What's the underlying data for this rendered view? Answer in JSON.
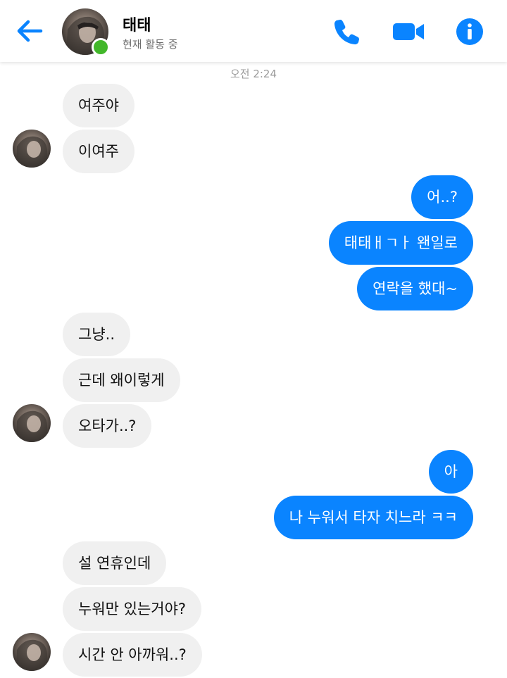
{
  "header": {
    "contact_name": "태태",
    "status": "현재 활동 중",
    "icons": {
      "back": "back-arrow-icon",
      "call": "phone-icon",
      "video": "video-camera-icon",
      "info": "info-icon"
    },
    "accent_color": "#0a84ff"
  },
  "timestamp": "오전 2:24",
  "messages": [
    {
      "from": "them",
      "text": "여주야"
    },
    {
      "from": "them",
      "text": "이여주"
    },
    {
      "from": "me",
      "text": "어..?"
    },
    {
      "from": "me",
      "text": "태태ㅐㄱㅏ 왠일로"
    },
    {
      "from": "me",
      "text": "연락을 했대~"
    },
    {
      "from": "them",
      "text": "그냥.."
    },
    {
      "from": "them",
      "text": "근데 왜이렇게"
    },
    {
      "from": "them",
      "text": "오타가..?"
    },
    {
      "from": "me",
      "text": "아"
    },
    {
      "from": "me",
      "text": "나 누워서 타자 치느라 ㅋㅋ"
    },
    {
      "from": "them",
      "text": "설 연휴인데"
    },
    {
      "from": "them",
      "text": "누워만 있는거야?"
    },
    {
      "from": "them",
      "text": "시간 안 아까워..?"
    }
  ]
}
